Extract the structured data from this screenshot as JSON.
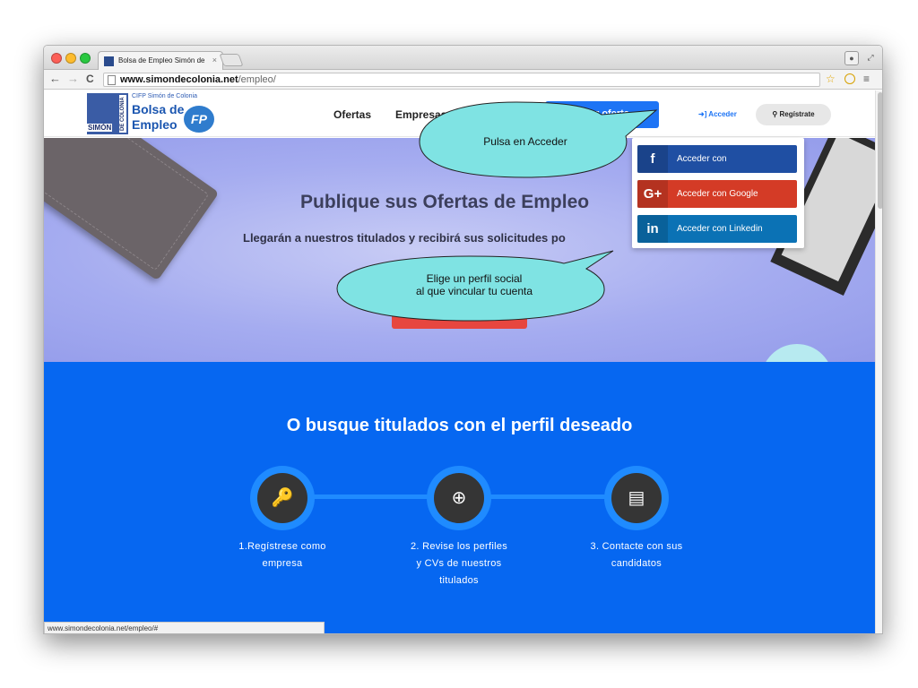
{
  "browser": {
    "tab_title": "Bolsa de Empleo Simón de",
    "tab_close": "×",
    "url_host": "www.simondecolonia.net",
    "url_path": "/empleo/",
    "back": "←",
    "forward": "→",
    "reload": "C",
    "star": "☆",
    "menu": "≡",
    "status_url": "www.simondecolonia.net/empleo/#"
  },
  "header": {
    "logo_small": "CIFP Simón de Colonia",
    "logo_line1": "Bolsa de",
    "logo_line2": "Empleo",
    "logo_simon": "SIMÓN",
    "logo_side": "DE COLONIA",
    "logo_fp": "FP",
    "menu_ofertas": "Ofertas",
    "menu_empresas": "Empresas",
    "cta_label": "r oferta",
    "acceder_label": "Acceder",
    "registrate_label": "Regístrate"
  },
  "hero": {
    "title": "Publique sus Ofertas de Empleo",
    "subtitle": "Llegarán a nuestros titulados y recibirá sus solicitudes po"
  },
  "dropdown": {
    "items": [
      {
        "icon": "f",
        "label": "Acceder con",
        "color": "#1f4fa3"
      },
      {
        "icon": "G+",
        "label": "Acceder con Google",
        "color": "#d43b26"
      },
      {
        "icon": "in",
        "label": "Acceder con Linkedin",
        "color": "#0b72b5"
      }
    ]
  },
  "section": {
    "title": "O busque titulados con el perfil deseado",
    "steps": [
      {
        "icon": "🔑",
        "label_1": "1.Regístrese como",
        "label_2": "empresa",
        "label_3": ""
      },
      {
        "icon": "⊕",
        "label_1": "2. Revise los perfiles",
        "label_2": "y CVs de nuestros",
        "label_3": "titulados"
      },
      {
        "icon": "▤",
        "label_1": "3. Contacte con sus",
        "label_2": "candidatos",
        "label_3": ""
      }
    ]
  },
  "callouts": {
    "acceder_text": "Pulsa en Acceder",
    "perfil_line1": "Elige un perfil social",
    "perfil_line2": "al que vincular tu cuenta"
  },
  "colors": {
    "brand_blue": "#0667f1",
    "callout_fill": "#7fe3e3",
    "hero_bg": "#a5acf0",
    "red_button": "#e7463f"
  }
}
